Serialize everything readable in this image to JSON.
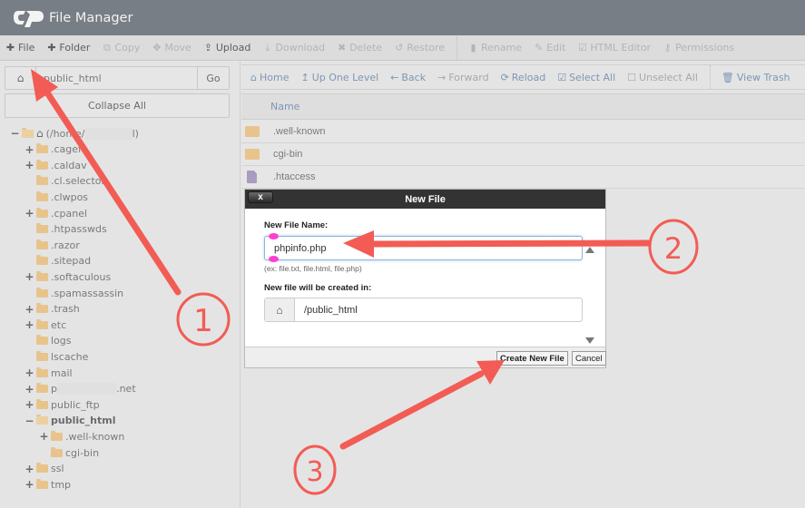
{
  "header": {
    "app_title": "File Manager",
    "logo": "cpanel-logo"
  },
  "toolbar": {
    "items": [
      {
        "label": "File",
        "icon": "plus-icon",
        "glyph": "✚",
        "enabled": true
      },
      {
        "label": "Folder",
        "icon": "plus-icon",
        "glyph": "✚",
        "enabled": true
      },
      {
        "label": "Copy",
        "icon": "copy-icon",
        "glyph": "⧉",
        "enabled": false
      },
      {
        "label": "Move",
        "icon": "move-icon",
        "glyph": "✥",
        "enabled": false
      },
      {
        "label": "Upload",
        "icon": "upload-icon",
        "glyph": "⇪",
        "enabled": true
      },
      {
        "label": "Download",
        "icon": "download-icon",
        "glyph": "⤓",
        "enabled": false
      },
      {
        "label": "Delete",
        "icon": "delete-icon",
        "glyph": "✖",
        "enabled": false
      },
      {
        "label": "Restore",
        "icon": "restore-icon",
        "glyph": "↺",
        "enabled": false
      },
      {
        "label": "Rename",
        "icon": "rename-icon",
        "glyph": "▮",
        "enabled": false
      },
      {
        "label": "Edit",
        "icon": "pencil-icon",
        "glyph": "✎",
        "enabled": false
      },
      {
        "label": "HTML Editor",
        "icon": "html-editor-icon",
        "glyph": "☑",
        "enabled": false
      },
      {
        "label": "Permissions",
        "icon": "key-icon",
        "glyph": "⚷",
        "enabled": false
      }
    ]
  },
  "left": {
    "path_value": "public_html",
    "home_icon": "⌂",
    "go_label": "Go",
    "collapse_label": "Collapse All",
    "tree": [
      {
        "label": "(/home/",
        "suffix": "l)",
        "blurred": "xxxxxxxx",
        "depth": 0,
        "toggle": "−",
        "open": true,
        "home": true
      },
      {
        "label": ".cagefs",
        "depth": 1,
        "toggle": "+"
      },
      {
        "label": ".caldav",
        "depth": 1,
        "toggle": "+"
      },
      {
        "label": ".cl.selector",
        "depth": 1,
        "toggle": ""
      },
      {
        "label": ".clwpos",
        "depth": 1,
        "toggle": ""
      },
      {
        "label": ".cpanel",
        "depth": 1,
        "toggle": "+"
      },
      {
        "label": ".htpasswds",
        "depth": 1,
        "toggle": ""
      },
      {
        "label": ".razor",
        "depth": 1,
        "toggle": ""
      },
      {
        "label": ".sitepad",
        "depth": 1,
        "toggle": ""
      },
      {
        "label": ".softaculous",
        "depth": 1,
        "toggle": "+"
      },
      {
        "label": ".spamassassin",
        "depth": 1,
        "toggle": ""
      },
      {
        "label": ".trash",
        "depth": 1,
        "toggle": "+"
      },
      {
        "label": "etc",
        "depth": 1,
        "toggle": "+"
      },
      {
        "label": "logs",
        "depth": 1,
        "toggle": ""
      },
      {
        "label": "lscache",
        "depth": 1,
        "toggle": ""
      },
      {
        "label": "mail",
        "depth": 1,
        "toggle": "+"
      },
      {
        "label": "p",
        "suffix": ".net",
        "blurred": "xxxxxxxxxx",
        "depth": 1,
        "toggle": "+"
      },
      {
        "label": "public_ftp",
        "depth": 1,
        "toggle": "+"
      },
      {
        "label": "public_html",
        "depth": 1,
        "toggle": "−",
        "open": true,
        "bold": true
      },
      {
        "label": ".well-known",
        "depth": 2,
        "toggle": "+"
      },
      {
        "label": "cgi-bin",
        "depth": 2,
        "toggle": ""
      },
      {
        "label": "ssl",
        "depth": 1,
        "toggle": "+"
      },
      {
        "label": "tmp",
        "depth": 1,
        "toggle": "+"
      }
    ]
  },
  "nav": {
    "items": [
      {
        "label": "Home",
        "icon": "home-icon",
        "glyph": "⌂",
        "enabled": true
      },
      {
        "label": "Up One Level",
        "icon": "level-up-icon",
        "glyph": "↥",
        "enabled": true
      },
      {
        "label": "Back",
        "icon": "arrow-left-icon",
        "glyph": "←",
        "enabled": true
      },
      {
        "label": "Forward",
        "icon": "arrow-right-icon",
        "glyph": "→",
        "enabled": false
      },
      {
        "label": "Reload",
        "icon": "reload-icon",
        "glyph": "⟳",
        "enabled": true
      },
      {
        "label": "Select All",
        "icon": "checkbox-checked-icon",
        "glyph": "☑",
        "enabled": true
      },
      {
        "label": "Unselect All",
        "icon": "checkbox-empty-icon",
        "glyph": "☐",
        "enabled": false
      },
      {
        "label": "View Trash",
        "icon": "trash-icon",
        "glyph": "🗑",
        "enabled": true
      }
    ]
  },
  "file_list": {
    "column_name": "Name",
    "rows": [
      {
        "name": ".well-known",
        "type": "folder"
      },
      {
        "name": "cgi-bin",
        "type": "folder"
      },
      {
        "name": ".htaccess",
        "type": "file"
      }
    ]
  },
  "dialog": {
    "title": "New File",
    "close_label": "x",
    "name_label": "New File Name:",
    "name_value": "phpinfo.php",
    "name_hint": "(ex: file.txt, file.html, file.php)",
    "location_label": "New file will be created in:",
    "location_value": "/public_html",
    "create_label": "Create New File",
    "cancel_label": "Cancel"
  },
  "annotations": {
    "color": "#f25c54",
    "markers": [
      "1",
      "2",
      "3"
    ]
  }
}
